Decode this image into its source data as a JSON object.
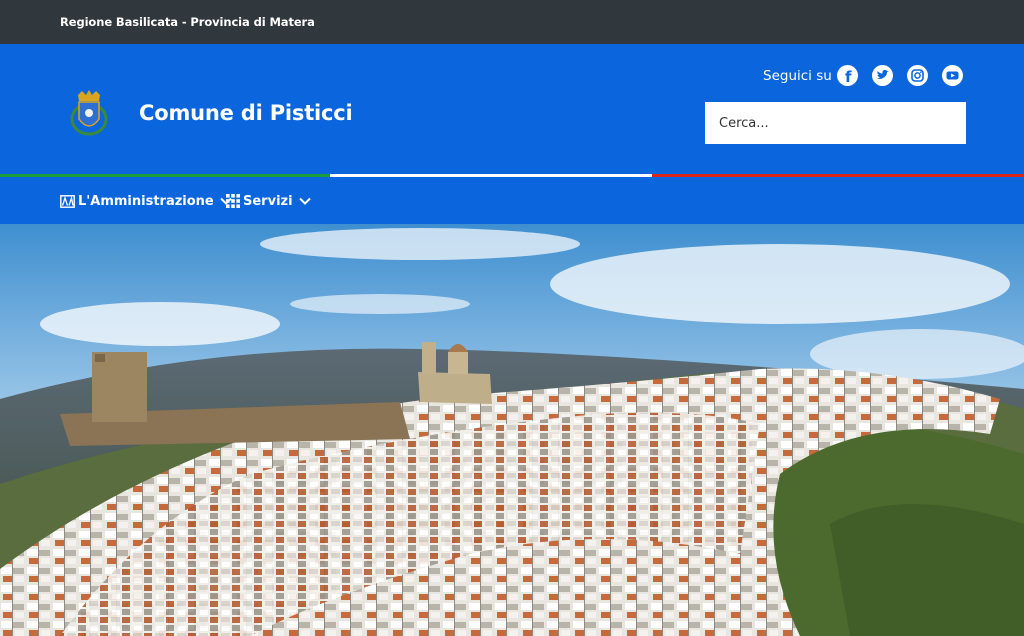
{
  "topbar": {
    "breadcrumb": "Regione Basilicata - Provincia di Matera"
  },
  "header": {
    "title": "Comune di Pisticci",
    "crest_icon": "coat-of-arms-icon",
    "social_label": "Seguici su",
    "social_icons": [
      "facebook-icon",
      "twitter-icon",
      "instagram-icon",
      "youtube-icon"
    ],
    "search_placeholder": "Cerca..."
  },
  "nav": {
    "items": [
      {
        "label": "L'Amministrazione",
        "icon": "administration-icon"
      },
      {
        "label": "Servizi",
        "icon": "grid-icon"
      }
    ]
  },
  "colors": {
    "topbar": "#30373d",
    "brand_blue": "#0b66dd",
    "flag_green": "#1a9e3a",
    "flag_white": "#ffffff",
    "flag_red": "#d8261c"
  }
}
